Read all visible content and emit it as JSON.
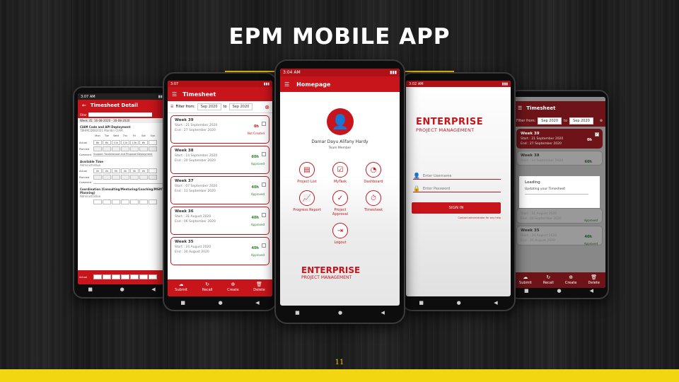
{
  "slide": {
    "title": "EPM MOBILE APP",
    "page_number": "11"
  },
  "colors": {
    "accent": "#c8141b",
    "rule": "#f2c70f",
    "footer": "#f2d60f"
  },
  "phone1": {
    "time": "3:07 AM",
    "title": "Timesheet Detail",
    "filter_label": "Filter",
    "week_range": "Week 35: 16-08-2020 - 30-08-2020",
    "project": "CIAM Code and API Deployment",
    "project_sub": "TBHMCD0B2021 Mandiri CIAM",
    "days": [
      "Mon",
      "Tue",
      "Wed",
      "Thu",
      "Fri",
      "Sat",
      "Sun"
    ],
    "row_actual": "Actual",
    "row_planned": "Planned",
    "actual_values": [
      "8h",
      "8h",
      "11h",
      "11h",
      "13h",
      "8h",
      ""
    ],
    "comment_label": "Comment",
    "comment_value": "Support Troubleshoot and Proposal Deployment",
    "section2": "Available Time",
    "section2_sub": "Administrative",
    "section2_values": [
      "0h",
      "0h",
      "0h",
      "0h",
      "0h",
      "0h",
      ""
    ],
    "section3": "Coordination (Consulting/Mentoring/Coaching/MGMT Planning)",
    "section3_sub": "Administrative",
    "total_actual_values": [
      "8h",
      "8h",
      "8h",
      "8h",
      "8h",
      "8h",
      ""
    ]
  },
  "phone2": {
    "time": "3:07",
    "title": "Timesheet",
    "filter_from": "Filter from:",
    "from_value": "Sep 2020",
    "to": "to",
    "to_value": "Sep 2020",
    "weeks": [
      {
        "week": "Week 39",
        "start": "Start : 21 September 2020",
        "end": "End : 27 September 2020",
        "hours": "0h",
        "status": "Not Created"
      },
      {
        "week": "Week 38",
        "start": "Start : 14 September 2020",
        "end": "End : 20 September 2020",
        "hours": "60h",
        "status": "Approved"
      },
      {
        "week": "Week 37",
        "start": "Start : 07 September 2020",
        "end": "End : 13 September 2020",
        "hours": "40h",
        "status": "Approved"
      },
      {
        "week": "Week 36",
        "start": "Start : 31 August 2020",
        "end": "End : 06 September 2020",
        "hours": "40h",
        "status": "Approved"
      },
      {
        "week": "Week 35",
        "start": "Start : 24 August 2020",
        "end": "End : 30 August 2020",
        "hours": "40h",
        "status": "Approved"
      }
    ],
    "actions": [
      "Submit",
      "Recall",
      "Create",
      "Delete"
    ]
  },
  "phone3": {
    "time": "3:04 AM",
    "title": "Homepage",
    "user_name": "Damar Dayu Alifany Hardy",
    "user_role": "Team Member",
    "menu": [
      "Project List",
      "MyTask",
      "Dashboard",
      "Progress Report",
      "Project Approval",
      "Timesheet",
      "Logout"
    ],
    "brand_line1": "ENTERPRISE",
    "brand_line2": "PROJECT MANAGEMENT"
  },
  "phone4": {
    "time": "3:02 AM",
    "brand_line1": "ENTERPRISE",
    "brand_line2": "PROJECT MANAGEMENT",
    "username_placeholder": "Enter Username",
    "password_placeholder": "Enter Password",
    "sign_in": "SIGN IN",
    "help": "Contact administrator for any help"
  },
  "phone5": {
    "title": "Timesheet",
    "filter_from": "Filter from:",
    "from_value": "Sep 2020",
    "to": "to",
    "to_value": "Sep 2020",
    "dialog_title": "Loading",
    "dialog_text": "Updating your Timesheet",
    "weeks": [
      {
        "week": "Week 39",
        "start": "Start : 21 September 2020",
        "end": "End : 27 September 2020",
        "hours": "0h",
        "status": ""
      },
      {
        "week": "Week 38",
        "start": "Start : 14 September 2020",
        "end": "",
        "hours": "60h",
        "status": ""
      },
      {
        "week": "",
        "start": "Start : 31 August 2020",
        "end": "End : 06 September 2020",
        "hours": "40h",
        "status": "Approved"
      },
      {
        "week": "Week 35",
        "start": "Start : 24 August 2020",
        "end": "End : 30 August 2020",
        "hours": "40h",
        "status": "Approved"
      }
    ],
    "actions": [
      "Submit",
      "Recall",
      "Create",
      "Delete"
    ]
  }
}
